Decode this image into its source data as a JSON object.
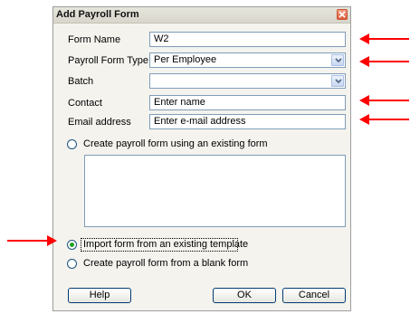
{
  "dialog": {
    "title": "Add Payroll Form",
    "close_glyph": "×",
    "fields": {
      "form_name": {
        "label": "Form Name",
        "value": "W2"
      },
      "form_type": {
        "label": "Payroll Form Type",
        "value": "Per Employee"
      },
      "batch": {
        "label": "Batch",
        "value": ""
      },
      "contact": {
        "label": "Contact",
        "value": "Enter name"
      },
      "email": {
        "label": "Email address",
        "value": "Enter e-mail address"
      }
    },
    "options": {
      "existing_form": "Create payroll form using an existing form",
      "import_template": "Import form from an existing template",
      "blank_form": "Create payroll form from a blank form"
    },
    "selected_option": "import_template",
    "buttons": {
      "help": "Help",
      "ok": "OK",
      "cancel": "Cancel"
    }
  },
  "colors": {
    "annotation_arrow": "#ff0000",
    "radio_dot": "#21a121",
    "field_border": "#7f9db9"
  }
}
